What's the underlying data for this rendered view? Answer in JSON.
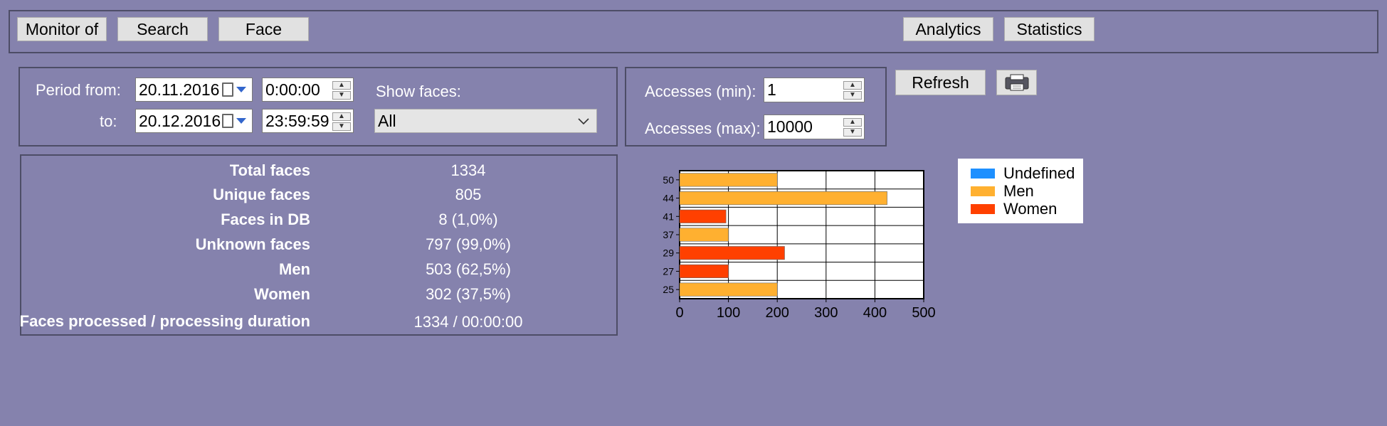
{
  "toolbar": {
    "monitor_label": "Monitor of",
    "search_label": "Search",
    "face_label": "Face",
    "analytics_label": "Analytics",
    "statistics_label": "Statistics"
  },
  "filters": {
    "period_from_label": "Period from:",
    "to_label": "to:",
    "date_from": "20.11.2016",
    "time_from": "0:00:00",
    "date_to": "20.12.2016",
    "time_to": "23:59:59",
    "show_faces_label": "Show faces:",
    "show_faces_value": "All"
  },
  "accesses": {
    "min_label": "Accesses (min):",
    "min_value": "1",
    "max_label": "Accesses (max):",
    "max_value": "10000"
  },
  "actions": {
    "refresh_label": "Refresh",
    "print_icon": "printer-icon"
  },
  "stats": [
    {
      "label": "Total faces",
      "value": "1334"
    },
    {
      "label": "Unique faces",
      "value": "805"
    },
    {
      "label": "Faces in DB",
      "value": "8 (1,0%)"
    },
    {
      "label": "Unknown faces",
      "value": "797 (99,0%)"
    },
    {
      "label": "Men",
      "value": "503 (62,5%)"
    },
    {
      "label": "Women",
      "value": "302 (37,5%)"
    },
    {
      "label": "Faces processed / processing duration",
      "value": "1334 / 00:00:00"
    }
  ],
  "colors": {
    "background": "#8582ad",
    "undefined": "#1e90ff",
    "men": "#ffb030",
    "women": "#ff4000"
  },
  "chart_data": {
    "type": "bar",
    "orientation": "horizontal",
    "categories": [
      "50",
      "44",
      "41",
      "37",
      "29",
      "27",
      "25"
    ],
    "values": [
      200,
      425,
      95,
      100,
      215,
      100,
      200
    ],
    "bar_series": [
      "Men",
      "Men",
      "Women",
      "Men",
      "Women",
      "Women",
      "Men"
    ],
    "xlim": [
      0,
      500
    ],
    "xticks": [
      "0",
      "100",
      "200",
      "300",
      "400",
      "500"
    ],
    "grid": true,
    "legend": [
      "Undefined",
      "Men",
      "Women"
    ],
    "legend_position": "right"
  }
}
